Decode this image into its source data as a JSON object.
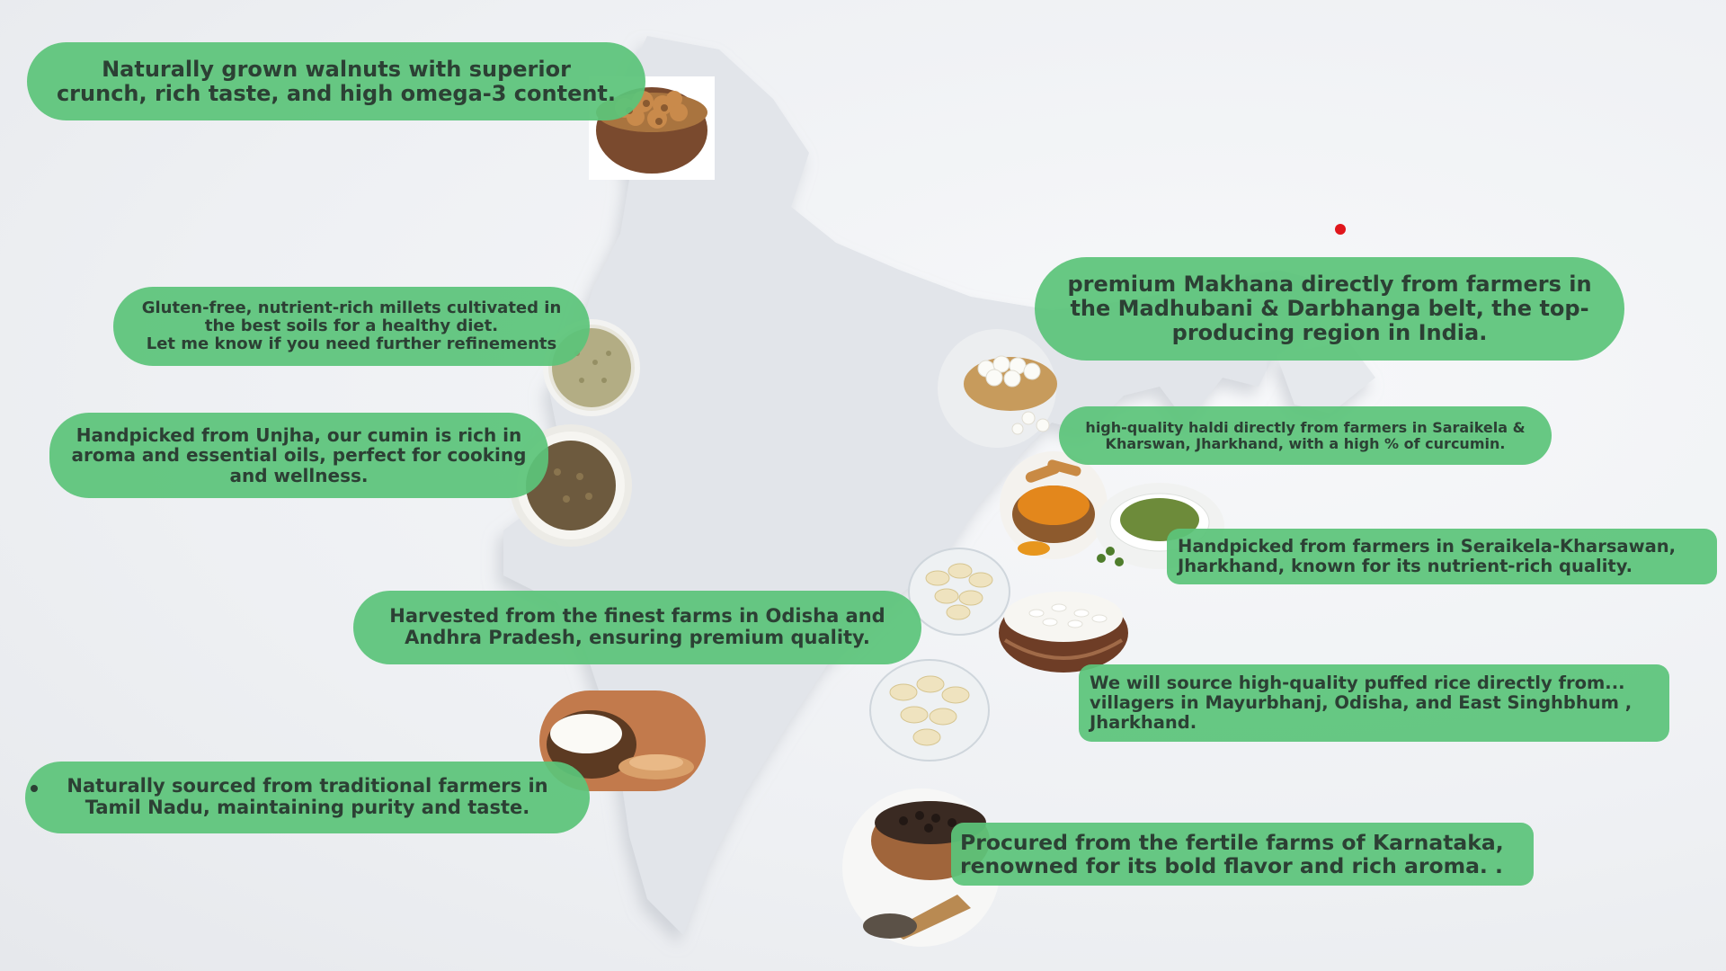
{
  "colors": {
    "pill": "#5bc47a",
    "pill_text": "#2c4034",
    "map": "#dfe3e8",
    "dot": "#e0161c"
  },
  "captions": {
    "walnut": "Naturally grown walnuts with superior\ncrunch, rich taste, and high omega-3 content.",
    "millet": "Gluten-free, nutrient-rich millets cultivated in\nthe best soils for a healthy diet.\nLet me know if you need further refinements",
    "cumin": "Handpicked from Unjha, our cumin is rich in\naroma and essential oils, perfect for cooking\nand wellness.",
    "cashew": "Harvested from the finest farms in Odisha and\nAndhra Pradesh, ensuring premium quality.",
    "coconut": "Naturally sourced from traditional farmers in\nTamil Nadu, maintaining purity and taste.",
    "makhana": "premium Makhana directly from farmers in\nthe Madhubani & Darbhanga belt, the top-\nproducing region in India.",
    "haldi": "high-quality haldi directly from farmers in Saraikela &\nKharswan, Jharkhand, with a high % of curcumin.",
    "moringa": "Handpicked from farmers in Seraikela-Kharsawan,\nJharkhand, known for its nutrient-rich quality.",
    "puffed_rice": "We will source high-quality puffed rice directly from...\nvillagers in Mayurbhanj, Odisha, and East Singhbhum ,\nJharkhand.",
    "pepper": "Procured from the fertile farms of Karnataka,\nrenowned for its bold flavor and rich aroma.  ."
  },
  "icons": [
    "walnut-bowl",
    "millet-bowl",
    "cumin-bowl",
    "cashew-bowl",
    "coconut",
    "makhana-basket",
    "turmeric",
    "moringa-powder",
    "puffed-rice-bowl",
    "black-pepper-bowl",
    "location-dot"
  ]
}
